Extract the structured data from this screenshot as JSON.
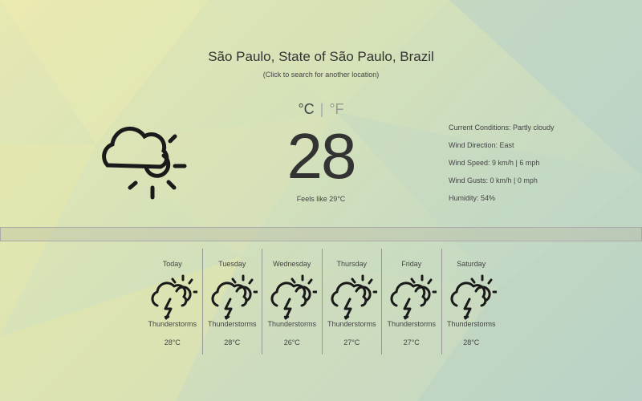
{
  "location": {
    "name": "São Paulo, State of São Paulo, Brazil",
    "hint": "(Click to search for another location)"
  },
  "current": {
    "icon": "partly-cloudy-icon",
    "unit_c": "°C",
    "unit_sep": "|",
    "unit_f": "°F",
    "temperature": "28",
    "feels_like": "Feels like 29°C",
    "details": {
      "conditions": "Current Conditions: Partly cloudy",
      "wind_direction": "Wind Direction: East",
      "wind_speed": "Wind Speed: 9 km/h | 6 mph",
      "wind_gusts": "Wind Gusts: 0 km/h | 0 mph",
      "humidity": "Humidity: 54%"
    }
  },
  "forecast": [
    {
      "day": "Today",
      "condition": "Thunderstorms",
      "temp": "28°C",
      "icon": "thunderstorm-icon"
    },
    {
      "day": "Tuesday",
      "condition": "Thunderstorms",
      "temp": "28°C",
      "icon": "thunderstorm-icon"
    },
    {
      "day": "Wednesday",
      "condition": "Thunderstorms",
      "temp": "26°C",
      "icon": "thunderstorm-icon"
    },
    {
      "day": "Thursday",
      "condition": "Thunderstorms",
      "temp": "27°C",
      "icon": "thunderstorm-icon"
    },
    {
      "day": "Friday",
      "condition": "Thunderstorms",
      "temp": "27°C",
      "icon": "thunderstorm-icon"
    },
    {
      "day": "Saturday",
      "condition": "Thunderstorms",
      "temp": "28°C",
      "icon": "thunderstorm-icon"
    }
  ],
  "colors": {
    "background_start": "#e7e8b2",
    "background_end": "#b9d2c8",
    "text": "#333333"
  }
}
